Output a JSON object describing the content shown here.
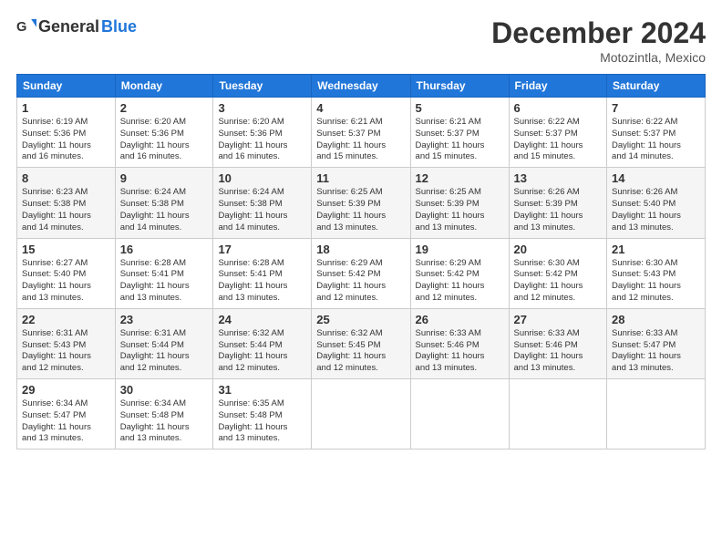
{
  "header": {
    "logo_general": "General",
    "logo_blue": "Blue",
    "month_title": "December 2024",
    "location": "Motozintla, Mexico"
  },
  "days_of_week": [
    "Sunday",
    "Monday",
    "Tuesday",
    "Wednesday",
    "Thursday",
    "Friday",
    "Saturday"
  ],
  "weeks": [
    [
      {
        "day": "1",
        "info": "Sunrise: 6:19 AM\nSunset: 5:36 PM\nDaylight: 11 hours\nand 16 minutes."
      },
      {
        "day": "2",
        "info": "Sunrise: 6:20 AM\nSunset: 5:36 PM\nDaylight: 11 hours\nand 16 minutes."
      },
      {
        "day": "3",
        "info": "Sunrise: 6:20 AM\nSunset: 5:36 PM\nDaylight: 11 hours\nand 16 minutes."
      },
      {
        "day": "4",
        "info": "Sunrise: 6:21 AM\nSunset: 5:37 PM\nDaylight: 11 hours\nand 15 minutes."
      },
      {
        "day": "5",
        "info": "Sunrise: 6:21 AM\nSunset: 5:37 PM\nDaylight: 11 hours\nand 15 minutes."
      },
      {
        "day": "6",
        "info": "Sunrise: 6:22 AM\nSunset: 5:37 PM\nDaylight: 11 hours\nand 15 minutes."
      },
      {
        "day": "7",
        "info": "Sunrise: 6:22 AM\nSunset: 5:37 PM\nDaylight: 11 hours\nand 14 minutes."
      }
    ],
    [
      {
        "day": "8",
        "info": "Sunrise: 6:23 AM\nSunset: 5:38 PM\nDaylight: 11 hours\nand 14 minutes."
      },
      {
        "day": "9",
        "info": "Sunrise: 6:24 AM\nSunset: 5:38 PM\nDaylight: 11 hours\nand 14 minutes."
      },
      {
        "day": "10",
        "info": "Sunrise: 6:24 AM\nSunset: 5:38 PM\nDaylight: 11 hours\nand 14 minutes."
      },
      {
        "day": "11",
        "info": "Sunrise: 6:25 AM\nSunset: 5:39 PM\nDaylight: 11 hours\nand 13 minutes."
      },
      {
        "day": "12",
        "info": "Sunrise: 6:25 AM\nSunset: 5:39 PM\nDaylight: 11 hours\nand 13 minutes."
      },
      {
        "day": "13",
        "info": "Sunrise: 6:26 AM\nSunset: 5:39 PM\nDaylight: 11 hours\nand 13 minutes."
      },
      {
        "day": "14",
        "info": "Sunrise: 6:26 AM\nSunset: 5:40 PM\nDaylight: 11 hours\nand 13 minutes."
      }
    ],
    [
      {
        "day": "15",
        "info": "Sunrise: 6:27 AM\nSunset: 5:40 PM\nDaylight: 11 hours\nand 13 minutes."
      },
      {
        "day": "16",
        "info": "Sunrise: 6:28 AM\nSunset: 5:41 PM\nDaylight: 11 hours\nand 13 minutes."
      },
      {
        "day": "17",
        "info": "Sunrise: 6:28 AM\nSunset: 5:41 PM\nDaylight: 11 hours\nand 13 minutes."
      },
      {
        "day": "18",
        "info": "Sunrise: 6:29 AM\nSunset: 5:42 PM\nDaylight: 11 hours\nand 12 minutes."
      },
      {
        "day": "19",
        "info": "Sunrise: 6:29 AM\nSunset: 5:42 PM\nDaylight: 11 hours\nand 12 minutes."
      },
      {
        "day": "20",
        "info": "Sunrise: 6:30 AM\nSunset: 5:42 PM\nDaylight: 11 hours\nand 12 minutes."
      },
      {
        "day": "21",
        "info": "Sunrise: 6:30 AM\nSunset: 5:43 PM\nDaylight: 11 hours\nand 12 minutes."
      }
    ],
    [
      {
        "day": "22",
        "info": "Sunrise: 6:31 AM\nSunset: 5:43 PM\nDaylight: 11 hours\nand 12 minutes."
      },
      {
        "day": "23",
        "info": "Sunrise: 6:31 AM\nSunset: 5:44 PM\nDaylight: 11 hours\nand 12 minutes."
      },
      {
        "day": "24",
        "info": "Sunrise: 6:32 AM\nSunset: 5:44 PM\nDaylight: 11 hours\nand 12 minutes."
      },
      {
        "day": "25",
        "info": "Sunrise: 6:32 AM\nSunset: 5:45 PM\nDaylight: 11 hours\nand 12 minutes."
      },
      {
        "day": "26",
        "info": "Sunrise: 6:33 AM\nSunset: 5:46 PM\nDaylight: 11 hours\nand 13 minutes."
      },
      {
        "day": "27",
        "info": "Sunrise: 6:33 AM\nSunset: 5:46 PM\nDaylight: 11 hours\nand 13 minutes."
      },
      {
        "day": "28",
        "info": "Sunrise: 6:33 AM\nSunset: 5:47 PM\nDaylight: 11 hours\nand 13 minutes."
      }
    ],
    [
      {
        "day": "29",
        "info": "Sunrise: 6:34 AM\nSunset: 5:47 PM\nDaylight: 11 hours\nand 13 minutes."
      },
      {
        "day": "30",
        "info": "Sunrise: 6:34 AM\nSunset: 5:48 PM\nDaylight: 11 hours\nand 13 minutes."
      },
      {
        "day": "31",
        "info": "Sunrise: 6:35 AM\nSunset: 5:48 PM\nDaylight: 11 hours\nand 13 minutes."
      },
      {
        "day": "",
        "info": ""
      },
      {
        "day": "",
        "info": ""
      },
      {
        "day": "",
        "info": ""
      },
      {
        "day": "",
        "info": ""
      }
    ]
  ]
}
